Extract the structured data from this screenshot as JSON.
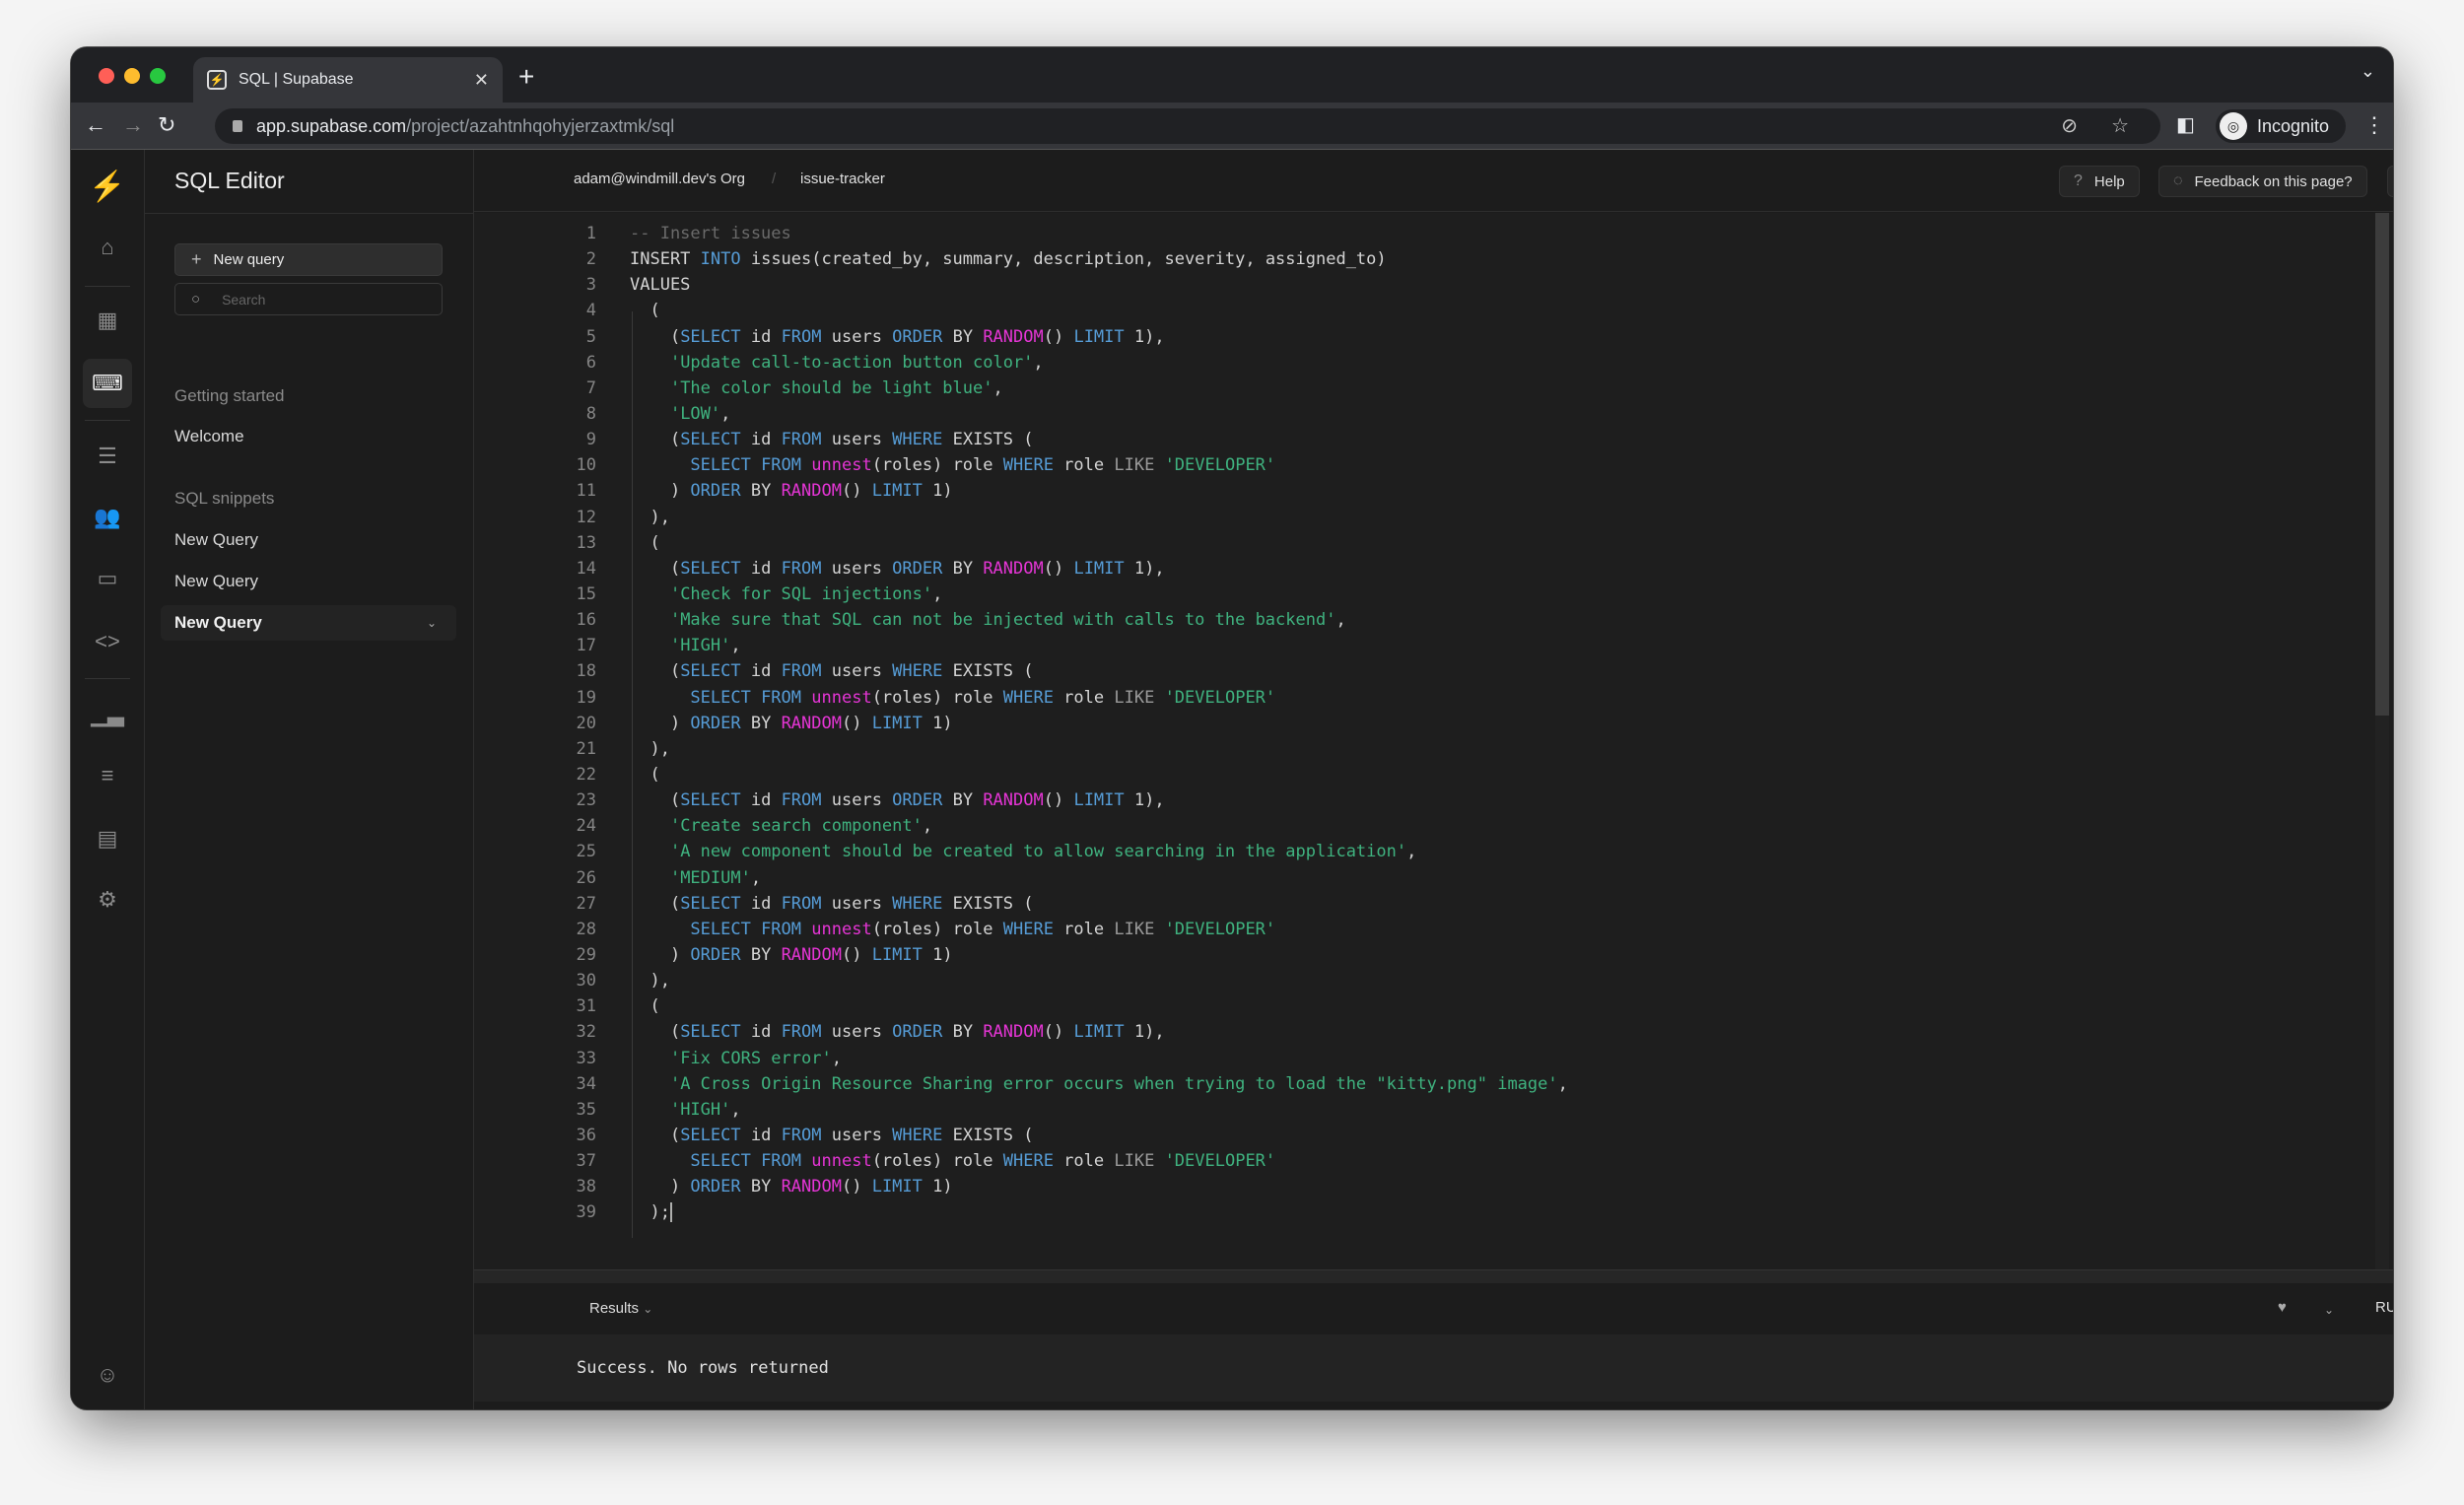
{
  "browser": {
    "tab_title": "SQL | Supabase",
    "url_host": "app.supabase.com",
    "url_path": "/project/azahtnhqohyjerzaxtmk/sql",
    "profile_label": "Incognito",
    "traffic_colors": [
      "#ff5f57",
      "#febc2e",
      "#28c840"
    ]
  },
  "rail": {
    "items": [
      "home-icon",
      "table-icon",
      "sql-editor-icon",
      "database-icon",
      "users-icon",
      "storage-icon",
      "code-icon",
      "reports-icon",
      "logs-icon",
      "docs-icon",
      "settings-icon"
    ],
    "active": "sql-editor-icon",
    "accent": "#3ecf8e"
  },
  "sidebar": {
    "title": "SQL Editor",
    "new_query_label": "New query",
    "search_placeholder": "Search",
    "getting_started_heading": "Getting started",
    "welcome_label": "Welcome",
    "snippets_heading": "SQL snippets",
    "snippets": [
      "New Query",
      "New Query",
      "New Query"
    ]
  },
  "header": {
    "org": "adam@windmill.dev's Org",
    "project": "issue-tracker",
    "help_label": "Help",
    "feedback_label": "Feedback on this page?"
  },
  "editor": {
    "lines": [
      [
        [
          "c",
          "-- Insert issues"
        ]
      ],
      [
        [
          "p",
          "INSERT "
        ],
        [
          "k",
          "INTO"
        ],
        [
          "p",
          " issues(created_by, summary, description, severity, assigned_to)"
        ]
      ],
      [
        [
          "p",
          "VALUES"
        ]
      ],
      [
        [
          "p",
          "  ("
        ]
      ],
      [
        [
          "p",
          "    ("
        ],
        [
          "k",
          "SELECT"
        ],
        [
          "p",
          " id "
        ],
        [
          "k",
          "FROM"
        ],
        [
          "p",
          " users "
        ],
        [
          "k",
          "ORDER"
        ],
        [
          "p",
          " BY "
        ],
        [
          "f",
          "RANDOM"
        ],
        [
          "p",
          "() "
        ],
        [
          "k",
          "LIMIT"
        ],
        [
          "p",
          " 1),"
        ]
      ],
      [
        [
          "p",
          "    "
        ],
        [
          "s",
          "'Update call-to-action button color'"
        ],
        [
          "p",
          ","
        ]
      ],
      [
        [
          "p",
          "    "
        ],
        [
          "s",
          "'The color should be light blue'"
        ],
        [
          "p",
          ","
        ]
      ],
      [
        [
          "p",
          "    "
        ],
        [
          "s",
          "'LOW'"
        ],
        [
          "p",
          ","
        ]
      ],
      [
        [
          "p",
          "    ("
        ],
        [
          "k",
          "SELECT"
        ],
        [
          "p",
          " id "
        ],
        [
          "k",
          "FROM"
        ],
        [
          "p",
          " users "
        ],
        [
          "k",
          "WHERE"
        ],
        [
          "p",
          " EXISTS ("
        ]
      ],
      [
        [
          "p",
          "      "
        ],
        [
          "k",
          "SELECT FROM"
        ],
        [
          "p",
          " "
        ],
        [
          "f",
          "unnest"
        ],
        [
          "p",
          "(roles) role "
        ],
        [
          "k",
          "WHERE"
        ],
        [
          "p",
          " role "
        ],
        [
          "o",
          "LIKE"
        ],
        [
          "p",
          " "
        ],
        [
          "s",
          "'DEVELOPER'"
        ]
      ],
      [
        [
          "p",
          "    ) "
        ],
        [
          "k",
          "ORDER"
        ],
        [
          "p",
          " BY "
        ],
        [
          "f",
          "RANDOM"
        ],
        [
          "p",
          "() "
        ],
        [
          "k",
          "LIMIT"
        ],
        [
          "p",
          " 1)"
        ]
      ],
      [
        [
          "p",
          "  ),"
        ]
      ],
      [
        [
          "p",
          "  ("
        ]
      ],
      [
        [
          "p",
          "    ("
        ],
        [
          "k",
          "SELECT"
        ],
        [
          "p",
          " id "
        ],
        [
          "k",
          "FROM"
        ],
        [
          "p",
          " users "
        ],
        [
          "k",
          "ORDER"
        ],
        [
          "p",
          " BY "
        ],
        [
          "f",
          "RANDOM"
        ],
        [
          "p",
          "() "
        ],
        [
          "k",
          "LIMIT"
        ],
        [
          "p",
          " 1),"
        ]
      ],
      [
        [
          "p",
          "    "
        ],
        [
          "s",
          "'Check for SQL injections'"
        ],
        [
          "p",
          ","
        ]
      ],
      [
        [
          "p",
          "    "
        ],
        [
          "s",
          "'Make sure that SQL can not be injected with calls to the backend'"
        ],
        [
          "p",
          ","
        ]
      ],
      [
        [
          "p",
          "    "
        ],
        [
          "s",
          "'HIGH'"
        ],
        [
          "p",
          ","
        ]
      ],
      [
        [
          "p",
          "    ("
        ],
        [
          "k",
          "SELECT"
        ],
        [
          "p",
          " id "
        ],
        [
          "k",
          "FROM"
        ],
        [
          "p",
          " users "
        ],
        [
          "k",
          "WHERE"
        ],
        [
          "p",
          " EXISTS ("
        ]
      ],
      [
        [
          "p",
          "      "
        ],
        [
          "k",
          "SELECT FROM"
        ],
        [
          "p",
          " "
        ],
        [
          "f",
          "unnest"
        ],
        [
          "p",
          "(roles) role "
        ],
        [
          "k",
          "WHERE"
        ],
        [
          "p",
          " role "
        ],
        [
          "o",
          "LIKE"
        ],
        [
          "p",
          " "
        ],
        [
          "s",
          "'DEVELOPER'"
        ]
      ],
      [
        [
          "p",
          "    ) "
        ],
        [
          "k",
          "ORDER"
        ],
        [
          "p",
          " BY "
        ],
        [
          "f",
          "RANDOM"
        ],
        [
          "p",
          "() "
        ],
        [
          "k",
          "LIMIT"
        ],
        [
          "p",
          " 1)"
        ]
      ],
      [
        [
          "p",
          "  ),"
        ]
      ],
      [
        [
          "p",
          "  ("
        ]
      ],
      [
        [
          "p",
          "    ("
        ],
        [
          "k",
          "SELECT"
        ],
        [
          "p",
          " id "
        ],
        [
          "k",
          "FROM"
        ],
        [
          "p",
          " users "
        ],
        [
          "k",
          "ORDER"
        ],
        [
          "p",
          " BY "
        ],
        [
          "f",
          "RANDOM"
        ],
        [
          "p",
          "() "
        ],
        [
          "k",
          "LIMIT"
        ],
        [
          "p",
          " 1),"
        ]
      ],
      [
        [
          "p",
          "    "
        ],
        [
          "s",
          "'Create search component'"
        ],
        [
          "p",
          ","
        ]
      ],
      [
        [
          "p",
          "    "
        ],
        [
          "s",
          "'A new component should be created to allow searching in the application'"
        ],
        [
          "p",
          ","
        ]
      ],
      [
        [
          "p",
          "    "
        ],
        [
          "s",
          "'MEDIUM'"
        ],
        [
          "p",
          ","
        ]
      ],
      [
        [
          "p",
          "    ("
        ],
        [
          "k",
          "SELECT"
        ],
        [
          "p",
          " id "
        ],
        [
          "k",
          "FROM"
        ],
        [
          "p",
          " users "
        ],
        [
          "k",
          "WHERE"
        ],
        [
          "p",
          " EXISTS ("
        ]
      ],
      [
        [
          "p",
          "      "
        ],
        [
          "k",
          "SELECT FROM"
        ],
        [
          "p",
          " "
        ],
        [
          "f",
          "unnest"
        ],
        [
          "p",
          "(roles) role "
        ],
        [
          "k",
          "WHERE"
        ],
        [
          "p",
          " role "
        ],
        [
          "o",
          "LIKE"
        ],
        [
          "p",
          " "
        ],
        [
          "s",
          "'DEVELOPER'"
        ]
      ],
      [
        [
          "p",
          "    ) "
        ],
        [
          "k",
          "ORDER"
        ],
        [
          "p",
          " BY "
        ],
        [
          "f",
          "RANDOM"
        ],
        [
          "p",
          "() "
        ],
        [
          "k",
          "LIMIT"
        ],
        [
          "p",
          " 1)"
        ]
      ],
      [
        [
          "p",
          "  ),"
        ]
      ],
      [
        [
          "p",
          "  ("
        ]
      ],
      [
        [
          "p",
          "    ("
        ],
        [
          "k",
          "SELECT"
        ],
        [
          "p",
          " id "
        ],
        [
          "k",
          "FROM"
        ],
        [
          "p",
          " users "
        ],
        [
          "k",
          "ORDER"
        ],
        [
          "p",
          " BY "
        ],
        [
          "f",
          "RANDOM"
        ],
        [
          "p",
          "() "
        ],
        [
          "k",
          "LIMIT"
        ],
        [
          "p",
          " 1),"
        ]
      ],
      [
        [
          "p",
          "    "
        ],
        [
          "s",
          "'Fix CORS error'"
        ],
        [
          "p",
          ","
        ]
      ],
      [
        [
          "p",
          "    "
        ],
        [
          "s",
          "'A Cross Origin Resource Sharing error occurs when trying to load the \"kitty.png\" image'"
        ],
        [
          "p",
          ","
        ]
      ],
      [
        [
          "p",
          "    "
        ],
        [
          "s",
          "'HIGH'"
        ],
        [
          "p",
          ","
        ]
      ],
      [
        [
          "p",
          "    ("
        ],
        [
          "k",
          "SELECT"
        ],
        [
          "p",
          " id "
        ],
        [
          "k",
          "FROM"
        ],
        [
          "p",
          " users "
        ],
        [
          "k",
          "WHERE"
        ],
        [
          "p",
          " EXISTS ("
        ]
      ],
      [
        [
          "p",
          "      "
        ],
        [
          "k",
          "SELECT FROM"
        ],
        [
          "p",
          " "
        ],
        [
          "f",
          "unnest"
        ],
        [
          "p",
          "(roles) role "
        ],
        [
          "k",
          "WHERE"
        ],
        [
          "p",
          " role "
        ],
        [
          "o",
          "LIKE"
        ],
        [
          "p",
          " "
        ],
        [
          "s",
          "'DEVELOPER'"
        ]
      ],
      [
        [
          "p",
          "    ) "
        ],
        [
          "k",
          "ORDER"
        ],
        [
          "p",
          " BY "
        ],
        [
          "f",
          "RANDOM"
        ],
        [
          "p",
          "() "
        ],
        [
          "k",
          "LIMIT"
        ],
        [
          "p",
          " 1)"
        ]
      ],
      [
        [
          "p",
          "  );"
        ]
      ]
    ]
  },
  "results": {
    "tab_label": "Results",
    "run_label": "RUN",
    "message": "Success. No rows returned"
  }
}
